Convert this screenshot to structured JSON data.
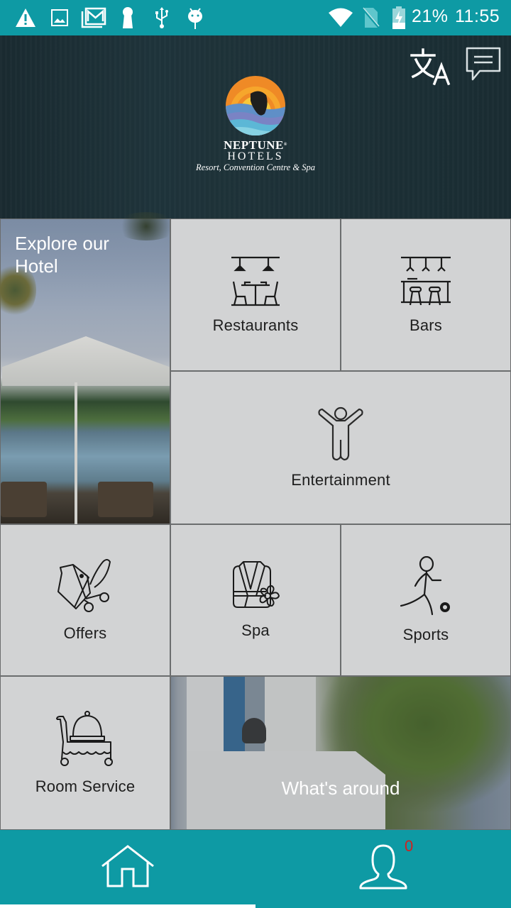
{
  "status_bar": {
    "left_icons": [
      "warning-icon",
      "image-icon",
      "gmail-icon",
      "keyhole-icon",
      "usb-icon",
      "android-debug-icon"
    ],
    "right_icons": [
      "wifi-icon",
      "no-sim-icon",
      "battery-charging-icon"
    ],
    "battery_percent": "21%",
    "time": "11:55"
  },
  "header": {
    "brand_name": "NEPTUNE",
    "brand_sub": "HOTELS",
    "tagline": "Resort, Convention Centre & Spa",
    "trademark": "®",
    "actions": {
      "translate_icon": "translate-icon",
      "chat_icon": "chat-icon"
    },
    "colors": {
      "background": "#1c2f35"
    }
  },
  "tiles": {
    "explore": {
      "label_line1": "Explore our",
      "label_line2": "Hotel"
    },
    "restaurants": {
      "label": "Restaurants",
      "icon": "restaurant-icon"
    },
    "bars": {
      "label": "Bars",
      "icon": "bar-icon"
    },
    "entertainment": {
      "label": "Entertainment",
      "icon": "person-cheering-icon"
    },
    "offers": {
      "label": "Offers",
      "icon": "coupon-scissors-icon"
    },
    "spa": {
      "label": "Spa",
      "icon": "bathrobe-flower-icon"
    },
    "sports": {
      "label": "Sports",
      "icon": "soccer-player-icon"
    },
    "room_service": {
      "label": "Room Service",
      "icon": "room-service-cart-icon"
    },
    "around": {
      "label": "What's around"
    }
  },
  "bottom_nav": {
    "home_icon": "home-icon",
    "profile_icon": "profile-icon",
    "notification_count": "0",
    "colors": {
      "background": "#0e9aa4",
      "badge": "#d22020"
    }
  }
}
